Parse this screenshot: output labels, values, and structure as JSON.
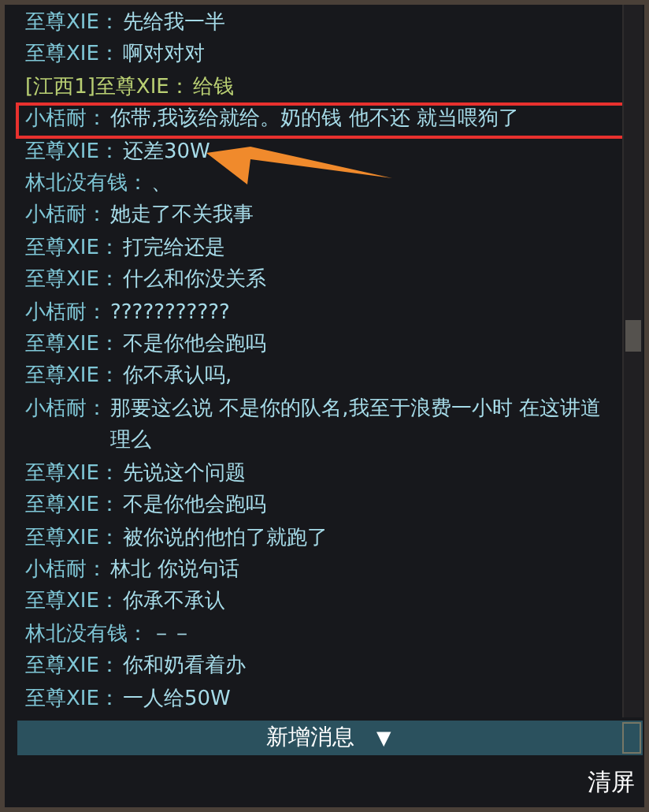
{
  "messages": [
    {
      "kind": "normal",
      "sender": "至尊XIE",
      "separator": "：",
      "text": "先给我一半",
      "boxed": false,
      "arrowed": false
    },
    {
      "kind": "normal",
      "sender": "至尊XIE",
      "separator": "：",
      "text": "啊对对对",
      "boxed": false,
      "arrowed": false
    },
    {
      "kind": "region",
      "sender": "[江西1]至尊XIE",
      "separator": "：",
      "text": "给钱",
      "boxed": false,
      "arrowed": false
    },
    {
      "kind": "normal",
      "sender": "小栝耐",
      "separator": "：",
      "text": "你带,我该给就给。奶的钱 他不还 就当喂狗了",
      "boxed": true,
      "arrowed": false
    },
    {
      "kind": "normal",
      "sender": "至尊XIE",
      "separator": "：",
      "text": "还差30W",
      "boxed": false,
      "arrowed": true
    },
    {
      "kind": "normal",
      "sender": "林北没有钱",
      "separator": "：",
      "text": "、",
      "boxed": false,
      "arrowed": false
    },
    {
      "kind": "normal",
      "sender": "小栝耐",
      "separator": "：",
      "text": "她走了不关我事",
      "boxed": false,
      "arrowed": false
    },
    {
      "kind": "normal",
      "sender": "至尊XIE",
      "separator": "：",
      "text": "打完给还是",
      "boxed": false,
      "arrowed": false
    },
    {
      "kind": "normal",
      "sender": "至尊XIE",
      "separator": "：",
      "text": "什么和你没关系",
      "boxed": false,
      "arrowed": false
    },
    {
      "kind": "normal",
      "sender": "小栝耐",
      "separator": "：",
      "text": "???????????",
      "boxed": false,
      "arrowed": false
    },
    {
      "kind": "normal",
      "sender": "至尊XIE",
      "separator": "：",
      "text": "不是你他会跑吗",
      "boxed": false,
      "arrowed": false
    },
    {
      "kind": "normal",
      "sender": "至尊XIE",
      "separator": "：",
      "text": "你不承认吗,",
      "boxed": false,
      "arrowed": false
    },
    {
      "kind": "normal",
      "sender": "小栝耐",
      "separator": "：",
      "text": "那要这么说 不是你的队名,我至于浪费一小时 在这讲道理么",
      "boxed": false,
      "arrowed": false
    },
    {
      "kind": "normal",
      "sender": "至尊XIE",
      "separator": "：",
      "text": "先说这个问题",
      "boxed": false,
      "arrowed": false
    },
    {
      "kind": "normal",
      "sender": "至尊XIE",
      "separator": "：",
      "text": "不是你他会跑吗",
      "boxed": false,
      "arrowed": false
    },
    {
      "kind": "normal",
      "sender": "至尊XIE",
      "separator": "：",
      "text": "被你说的他怕了就跑了",
      "boxed": false,
      "arrowed": false
    },
    {
      "kind": "normal",
      "sender": "小栝耐",
      "separator": "：",
      "text": "林北 你说句话",
      "boxed": false,
      "arrowed": false
    },
    {
      "kind": "normal",
      "sender": "至尊XIE",
      "separator": "：",
      "text": "你承不承认",
      "boxed": false,
      "arrowed": false
    },
    {
      "kind": "normal",
      "sender": "林北没有钱",
      "separator": "：",
      "text": "－－",
      "boxed": false,
      "arrowed": false
    },
    {
      "kind": "normal",
      "sender": "至尊XIE",
      "separator": "：",
      "text": "你和奶看着办",
      "boxed": false,
      "arrowed": false
    },
    {
      "kind": "normal",
      "sender": "至尊XIE",
      "separator": "：",
      "text": "一人给50W",
      "boxed": false,
      "arrowed": false
    }
  ],
  "new_messages_bar": {
    "label": "新增消息",
    "arrow": "▼"
  },
  "clear_button": "清屏"
}
